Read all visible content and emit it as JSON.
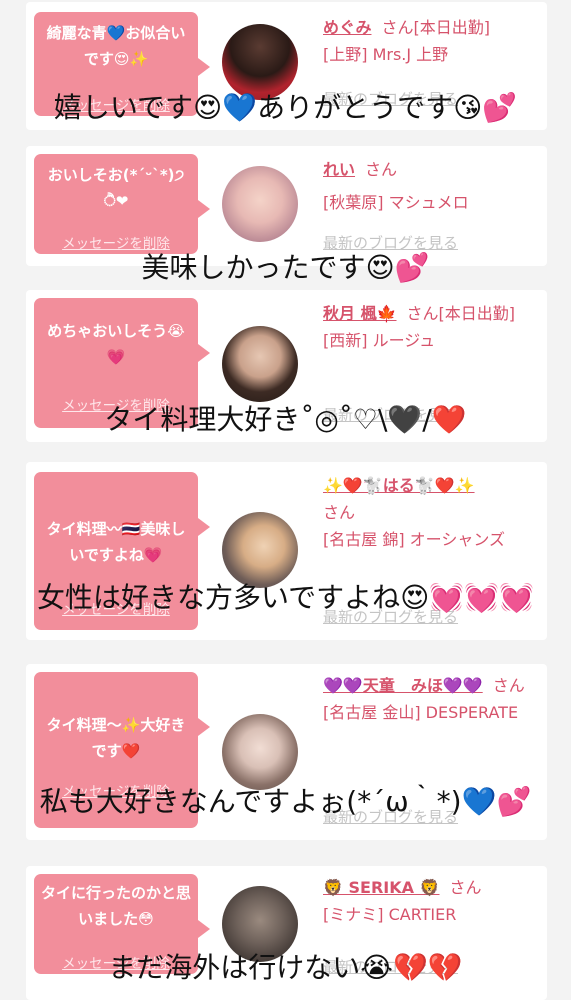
{
  "cards": [
    {
      "message": "綺麗な青💙お似合いです😍✨",
      "delete_label": "メッセージを削除",
      "name": "めぐみ",
      "san_label": "さん[本日出勤]",
      "location": "[上野] Mrs.J 上野",
      "blog_link": "最新のブログを見る"
    },
    {
      "message": "おいしそお(*ˊᵕˋ*)੭ ੈ❤",
      "delete_label": "メッセージを削除",
      "name": "れい",
      "san_label": "さん",
      "location": "[秋葉原] マシュメロ",
      "blog_link": "最新のブログを見る"
    },
    {
      "message": "めちゃおいしそう😭💗",
      "delete_label": "メッセージを削除",
      "name": "秋月 楓🍁",
      "san_label": "さん[本日出勤]",
      "location": "[西新] ルージュ",
      "blog_link": "最新のブログを見る"
    },
    {
      "message": "タイ料理〰🇹🇭美味しいですよね💗",
      "delete_label": "メッセージを削除",
      "name": "✨❤️🐩はる🐩❤️✨",
      "san_label": "さん",
      "location": "[名古屋 錦] オーシャンズ",
      "blog_link": "最新のブログを見る"
    },
    {
      "message": "タイ料理〜✨大好きです❤️",
      "delete_label": "メッセージを削除",
      "name": "💜💜天童　みほ💜💜",
      "san_label": "さん",
      "location": "[名古屋 金山] DESPERATE",
      "blog_link": "最新のブログを見る"
    },
    {
      "message": "タイに行ったのかと思いました😳",
      "delete_label": "メッセージを削除",
      "name": "🦁 SERIKA 🦁",
      "san_label": "さん",
      "location": "[ミナミ] CARTIER",
      "blog_link": "最新のブログを見る"
    }
  ],
  "captions": [
    "嬉しいです😍💙ありがとうです😘💕",
    "美味しかったです😍💕",
    "タイ料理大好き˚◎˚♡\\🖤/❤️",
    "女性は好きな方多いですよね😍💓💓💓",
    "私も大好きなんですよぉ(*´ω｀*)💙💕",
    "まだ海外は行けない😭💔💔"
  ]
}
